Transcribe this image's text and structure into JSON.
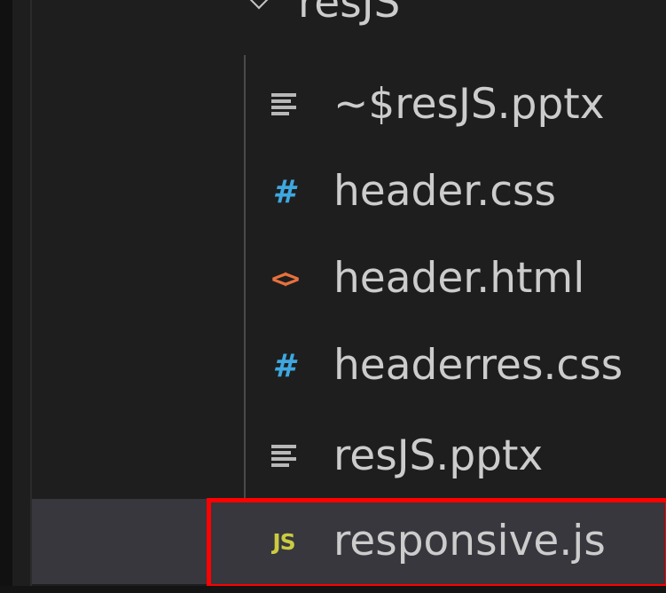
{
  "explorer": {
    "folder": {
      "label": "resJS",
      "icon": "chevron-down-icon"
    },
    "files": [
      {
        "label": "~$resJS.pptx",
        "icon": "lines-icon",
        "icon_color": "#b8b8b8",
        "selected": false
      },
      {
        "label": "header.css",
        "icon": "hash-icon",
        "icon_glyph": "#",
        "icon_color": "#3ea7e0",
        "selected": false
      },
      {
        "label": "header.html",
        "icon": "angle-brackets-icon",
        "icon_glyph": "<>",
        "icon_color": "#e8713d",
        "selected": false
      },
      {
        "label": "headerres.css",
        "icon": "hash-icon",
        "icon_glyph": "#",
        "icon_color": "#3ea7e0",
        "selected": false
      },
      {
        "label": "resJS.pptx",
        "icon": "lines-icon",
        "icon_color": "#b8b8b8",
        "selected": false
      },
      {
        "label": "responsive.js",
        "icon": "js-icon",
        "icon_glyph": "JS",
        "icon_color": "#cbcb41",
        "selected": true
      }
    ]
  },
  "colors": {
    "background": "#1e1e1e",
    "selected_row": "#37373d",
    "highlight": "#ff0000",
    "text": "#cccccc"
  }
}
